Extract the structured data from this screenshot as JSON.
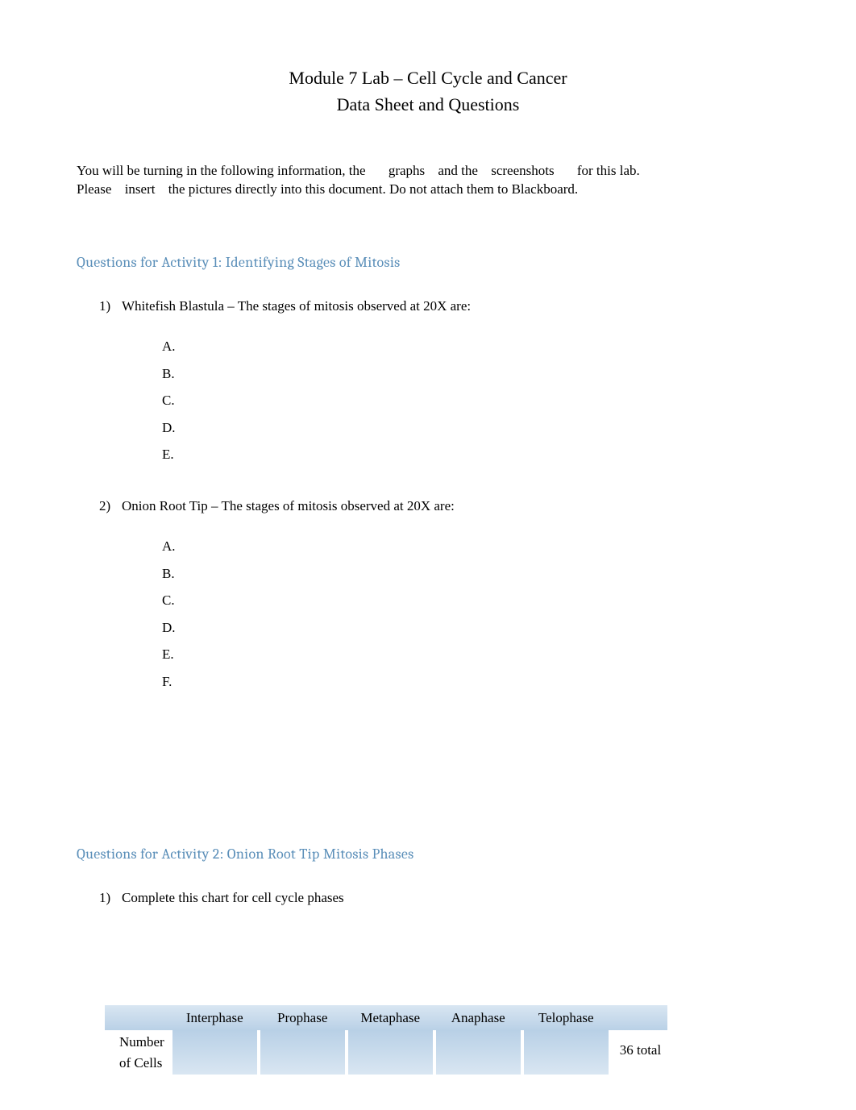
{
  "title": {
    "line1": "Module 7 Lab – Cell Cycle and Cancer",
    "line2": "Data Sheet and Questions"
  },
  "intro": {
    "p1a": "You will be turning in the following information, the",
    "p1b": "graphs",
    "p1c": "and the",
    "p1d": "screenshots",
    "p1e": "for this lab.",
    "p2a": "Please",
    "p2b": "insert",
    "p2c": "the pictures directly into this document. Do not attach them to Blackboard."
  },
  "activity1": {
    "heading": "Questions for Activity 1: Identifying Stages of Mitosis",
    "q1": {
      "num": "1)",
      "prompt": "Whitefish Blastula – The stages of mitosis observed at 20X are:",
      "letters": [
        "A.",
        "B.",
        "C.",
        "D.",
        "E."
      ]
    },
    "q2": {
      "num": "2)",
      "prompt": "Onion Root Tip – The stages of mitosis observed at 20X are:",
      "letters": [
        "A.",
        "B.",
        "C.",
        "D.",
        "E.",
        "F."
      ]
    }
  },
  "activity2": {
    "heading": "Questions for Activity 2: Onion Root Tip Mitosis Phases",
    "q1": {
      "num": "1)",
      "prompt": "Complete this chart for cell cycle phases"
    },
    "table": {
      "headers": [
        "Interphase",
        "Prophase",
        "Metaphase",
        "Anaphase",
        "Telophase"
      ],
      "row1_label_a": "Number",
      "row1_label_b": "of Cells",
      "row1_total": "36 total"
    }
  }
}
